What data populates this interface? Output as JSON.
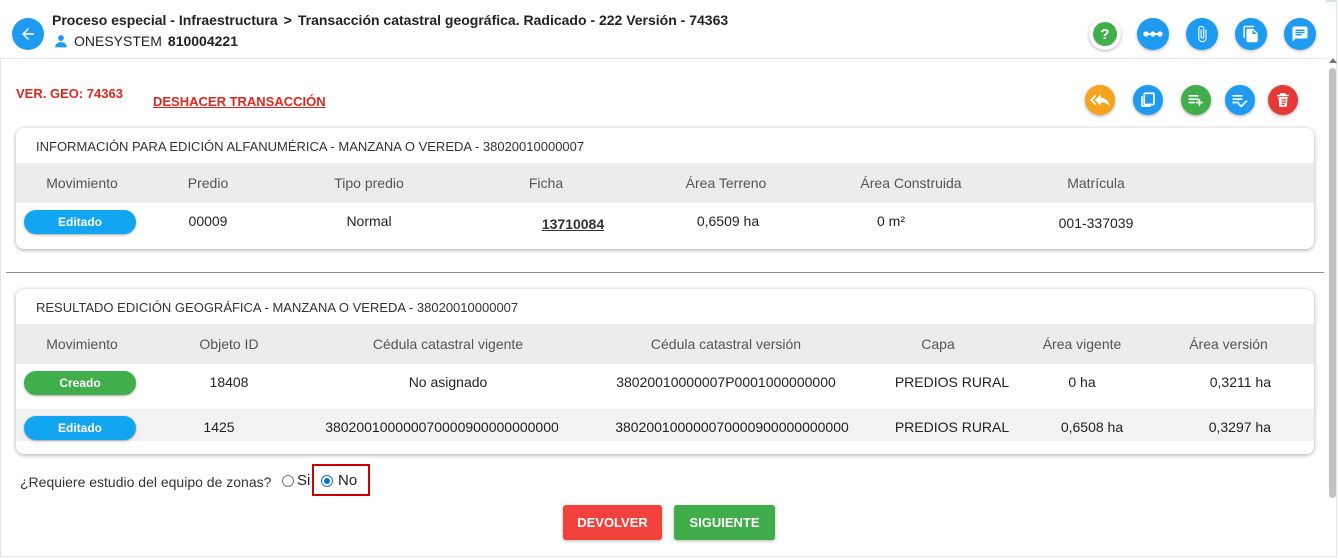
{
  "header": {
    "breadcrumb": [
      "Proceso especial - Infraestructura",
      "Transacción catastral geográfica. Radicado - 222 Versión - 74363"
    ],
    "breadcrumb_separator": ">",
    "user_name": "ONESYSTEM",
    "user_id": "810004221",
    "icons": [
      "help-icon",
      "more-icon",
      "attachment-icon",
      "documents-icon",
      "comments-icon"
    ]
  },
  "toolbar": {
    "ver_geo": "VER. GEO: 74363",
    "undo_label": "DESHACER TRANSACCIÓN",
    "icons": [
      "reply-all-icon",
      "copy-icon",
      "add-list-icon",
      "checklist-icon",
      "delete-icon"
    ]
  },
  "alfa": {
    "title": "INFORMACIÓN PARA EDICIÓN ALFANUMÉRICA - MANZANA O VEREDA - 38020010000007",
    "columns": [
      "Movimiento",
      "Predio",
      "Tipo predio",
      "Ficha",
      "Área Terreno",
      "Área Construida",
      "Matrícula"
    ],
    "rows": [
      {
        "movimiento": "Editado",
        "predio": "00009",
        "tipo": "Normal",
        "ficha": "13710084",
        "area_terreno": "0,6509 ha",
        "area_construida": "0 m²",
        "matricula": "001-337039"
      }
    ]
  },
  "geo": {
    "title": "RESULTADO EDICIÓN GEOGRÁFICA - MANZANA O VEREDA - 38020010000007",
    "columns": [
      "Movimiento",
      "Objeto ID",
      "Cédula catastral vigente",
      "Cédula catastral versión",
      "Capa",
      "Área vigente",
      "Área versión"
    ],
    "rows": [
      {
        "movimiento": "Creado",
        "objeto_id": "18408",
        "cedula_vigente": "No asignado",
        "cedula_version": "38020010000007P0001000000000",
        "capa": "PREDIOS RURAL",
        "area_vigente": "0 ha",
        "area_version": "0,3211 ha"
      },
      {
        "movimiento": "Editado",
        "objeto_id": "1425",
        "cedula_vigente": "380200100000070000900000000000",
        "cedula_version": "380200100000070000900000000000",
        "capa": "PREDIOS RURAL",
        "area_vigente": "0,6508 ha",
        "area_version": "0,3297 ha"
      }
    ]
  },
  "question": {
    "text": "¿Requiere estudio del equipo de zonas?",
    "options": [
      "Si",
      "No"
    ],
    "selected": "No"
  },
  "buttons": {
    "return_label": "DEVOLVER",
    "next_label": "SIGUIENTE"
  },
  "colors": {
    "primary": "#1e9bf0",
    "danger": "#e0261c",
    "success": "#3fae4b",
    "warning": "#f7a21b"
  }
}
